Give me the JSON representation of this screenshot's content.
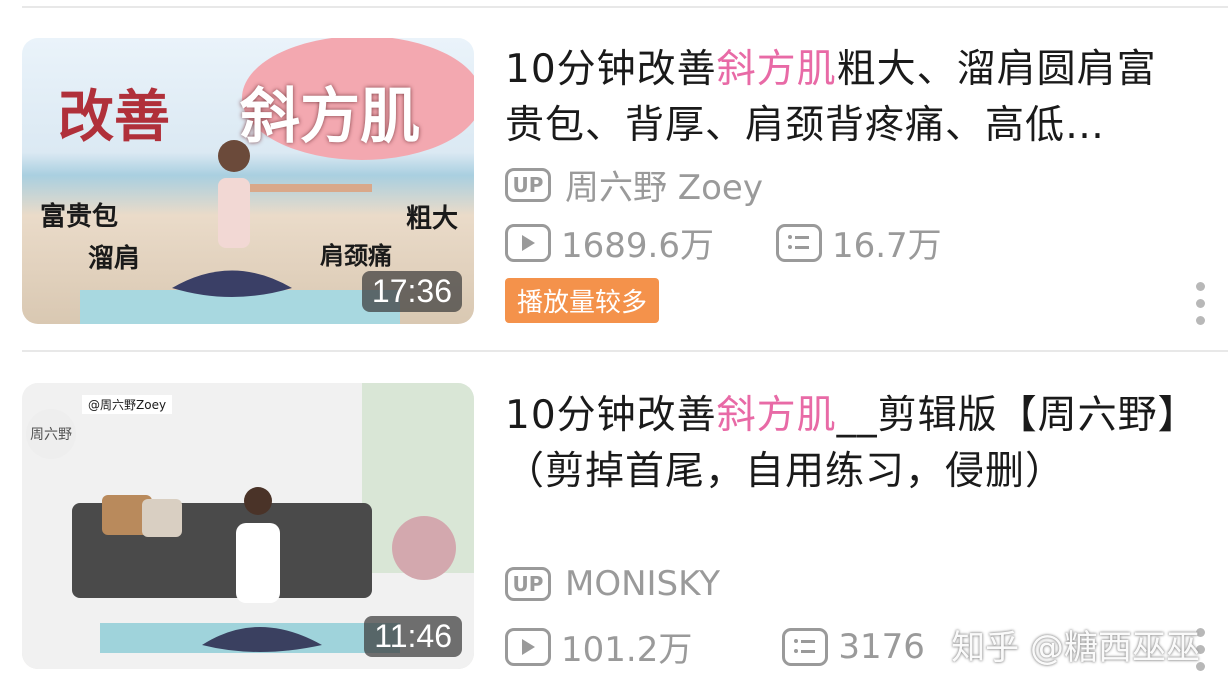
{
  "videos": [
    {
      "title_part1": "10分钟改善",
      "title_highlight": "斜方肌",
      "title_part2": "粗大、溜肩圆肩富贵包、背厚、肩颈背疼痛、高低…",
      "uploader": "周六野 Zoey",
      "views": "1689.6万",
      "comments": "16.7万",
      "tag": "播放量较多",
      "duration": "17:36",
      "thumb_text": {
        "big1": "改善",
        "big2": "斜方肌",
        "a": "富贵包",
        "b": "溜肩",
        "c": "肩颈痛",
        "d": "粗大"
      }
    },
    {
      "title_part1": "10分钟改善",
      "title_highlight": "斜方肌",
      "title_part2": "__剪辑版【周六野】（剪掉首尾，自用练习，侵删）",
      "uploader": "MONISKY",
      "views": "101.2万",
      "comments": "3176",
      "duration": "11:46",
      "thumb_text": {
        "handle": "@周六野Zoey",
        "logo": "周六野"
      }
    }
  ],
  "badge_label": "UP",
  "watermark": "知乎 @糖西巫巫",
  "icons": [
    "up-icon",
    "play-icon",
    "comment-list-icon",
    "more-vertical-icon"
  ],
  "colors": {
    "highlight": "#e86aa6",
    "tag_bg": "#f4924b",
    "meta": "#9a9a9a"
  }
}
